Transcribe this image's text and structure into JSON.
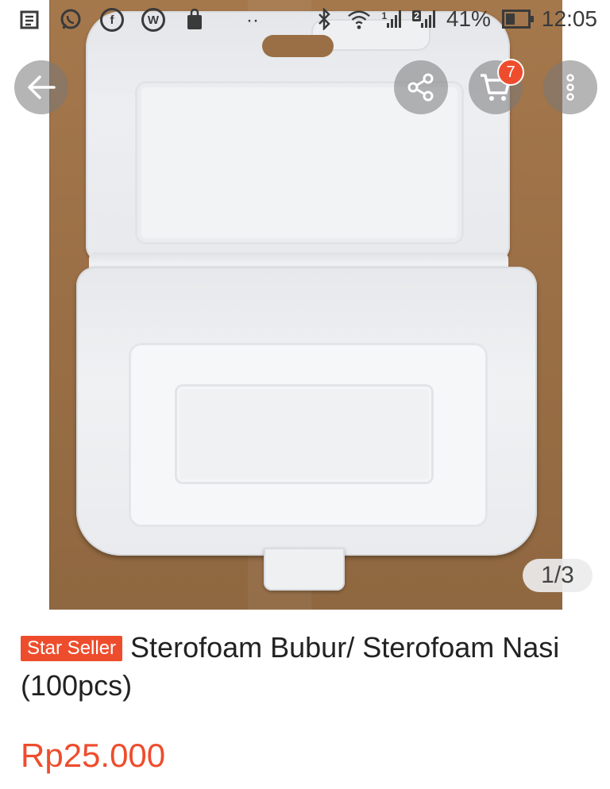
{
  "status_bar": {
    "battery_percent": "41%",
    "time": "12:05",
    "sim1_label": "1",
    "sim2_label": "2",
    "notification_icons": [
      "news-icon",
      "whatsapp-icon",
      "facebook-icon",
      "wordpress-icon",
      "shopping-bag-icon",
      "more-notifications-icon"
    ],
    "dots": "··"
  },
  "gallery": {
    "page_indicator": "1/3",
    "current_page": 1,
    "total_pages": 3
  },
  "toolbar": {
    "cart_count": "7",
    "icons": [
      "back-arrow-icon",
      "share-icon",
      "cart-icon",
      "more-vertical-icon"
    ]
  },
  "product": {
    "badge": "Star Seller",
    "title": "Sterofoam Bubur/ Sterofoam Nasi (100pcs)",
    "price": "Rp25.000"
  },
  "colors": {
    "accent": "#ee4d2d",
    "text": "#222222"
  }
}
